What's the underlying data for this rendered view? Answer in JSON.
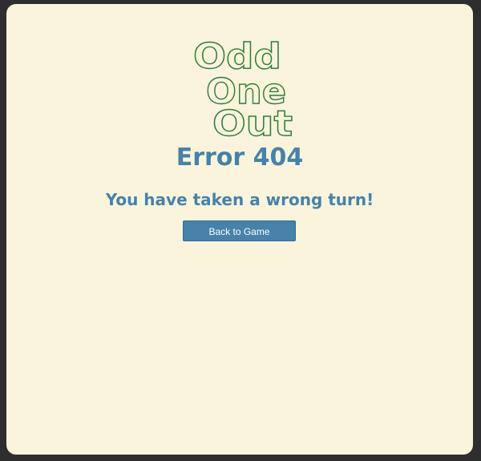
{
  "logo": {
    "lines": [
      "Odd",
      "One",
      "Out"
    ],
    "stroke_color": "#2e7d3c"
  },
  "error": {
    "title": "Error 404",
    "message": "You have taken a wrong turn!"
  },
  "actions": {
    "back_label": "Back to Game"
  },
  "colors": {
    "background": "#faf4dc",
    "accent": "#4682a9",
    "frame": "#2e2e2e"
  }
}
